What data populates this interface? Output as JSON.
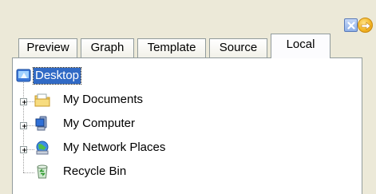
{
  "title_buttons": {
    "close_icon": "close-icon",
    "next_icon": "arrow-right-circle-icon"
  },
  "tabs": [
    {
      "label": "Preview",
      "active": false
    },
    {
      "label": "Graph",
      "active": false
    },
    {
      "label": "Template",
      "active": false
    },
    {
      "label": "Source",
      "active": false
    },
    {
      "label": "Local",
      "active": true
    }
  ],
  "tree": {
    "root": {
      "label": "Desktop",
      "icon": "desktop-icon",
      "selected": true
    },
    "children": [
      {
        "label": "My Documents",
        "icon": "folder-icon",
        "expandable": true
      },
      {
        "label": "My Computer",
        "icon": "computer-icon",
        "expandable": true
      },
      {
        "label": "My Network Places",
        "icon": "network-places-icon",
        "expandable": true
      },
      {
        "label": "Recycle Bin",
        "icon": "recycle-bin-icon",
        "expandable": false
      }
    ]
  },
  "colors": {
    "selection": "#316ac5",
    "chrome": "#ece9d8",
    "tab_border": "#919b9c"
  }
}
